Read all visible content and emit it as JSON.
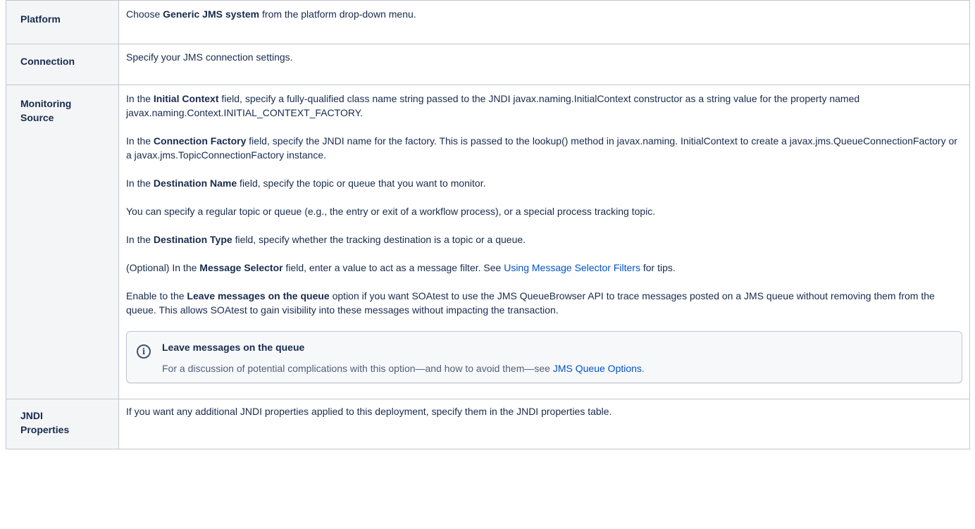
{
  "rows": {
    "platform": {
      "label": "Platform",
      "pre": "Choose ",
      "bold": "Generic JMS system",
      "post": " from the platform drop-down menu."
    },
    "connection": {
      "label": "Connection",
      "text": "Specify your JMS connection settings."
    },
    "monitoring": {
      "label_line1": "Monitoring",
      "label_line2": "Source",
      "p1": {
        "pre": "In the ",
        "bold": "Initial Context",
        "post": " field, specify a fully-qualified class name string passed to the JNDI javax.naming.InitialContext constructor as a string value for the property named javax.naming.Context.INITIAL_CONTEXT_FACTORY."
      },
      "p2": {
        "pre": "In the ",
        "bold": "Connection Factory",
        "post": " field, specify the JNDI name for the factory. This is passed to the lookup() method in javax.naming. InitialContext to create a javax.jms.QueueConnectionFactory or a javax.jms.TopicConnectionFactory instance."
      },
      "p3": {
        "pre": "In the ",
        "bold": "Destination Name",
        "post": " field, specify the topic or queue that you want to monitor."
      },
      "p4": {
        "text": "You can specify a regular topic or queue (e.g., the entry or exit of a workflow process), or a special process tracking topic."
      },
      "p5": {
        "pre": "In the ",
        "bold": "Destination Type",
        "post": " field, specify whether the tracking destination is a topic or a queue."
      },
      "p6": {
        "pre": "(Optional) In the ",
        "bold": "Message Selector",
        "mid": " field,  enter a value to act as a message filter. See ",
        "link": "Using Message Selector Filters",
        "post": " for tips."
      },
      "p7": {
        "pre": "Enable to the ",
        "bold": "Leave messages on the queue",
        "post": " option if you want SOAtest to use the JMS QueueBrowser API to trace messages posted on a JMS queue without removing them from the queue. This allows SOAtest to gain visibility into these messages without impacting the transaction."
      },
      "info": {
        "icon": "info-icon",
        "title": "Leave messages on the queue",
        "pre": "For a discussion of potential complications with this option—and how to avoid them—see ",
        "link": "JMS Queue Options",
        "post": "."
      }
    },
    "jndi": {
      "label_line1": "JNDI",
      "label_line2": "Properties",
      "text": "If you want any additional JNDI properties applied to this deployment, specify them in the JNDI properties table."
    }
  },
  "colors": {
    "text": "#172b4d",
    "header_bg": "#f4f5f7",
    "border": "#c1c7d0",
    "link": "#0052cc",
    "panel_bg": "#f7f8fa"
  }
}
